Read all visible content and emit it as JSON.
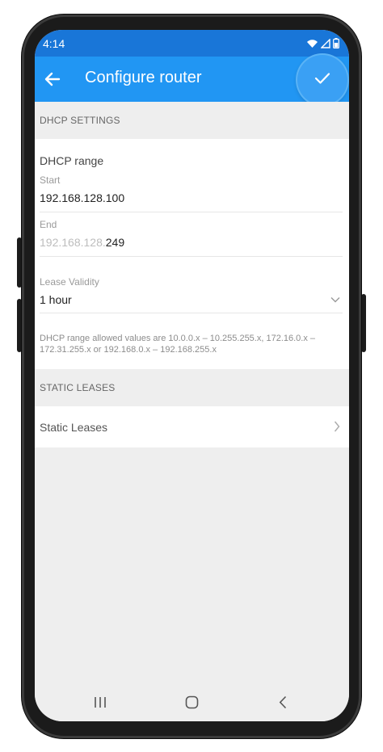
{
  "status_bar": {
    "time": "4:14",
    "icons": [
      "wifi-icon",
      "signal-icon",
      "battery-icon"
    ]
  },
  "app_bar": {
    "title": "Configure router",
    "back_icon": "arrow-left-icon",
    "confirm_icon": "check-icon"
  },
  "dhcp": {
    "section_title": "DHCP SETTINGS",
    "range_title": "DHCP range",
    "start_label": "Start",
    "start_value": "192.168.128.100",
    "end_label": "End",
    "end_prefix": "192.168.128.",
    "end_suffix": "249",
    "lease_label": "Lease Validity",
    "lease_value": "1 hour",
    "hint": "DHCP range allowed values are 10.0.0.x – 10.255.255.x, 172.16.0.x – 172.31.255.x or 192.168.0.x – 192.168.255.x"
  },
  "static": {
    "section_title": "STATIC LEASES",
    "item_label": "Static Leases"
  },
  "colors": {
    "status_bar": "#1976d8",
    "app_bar": "#2196f3",
    "background": "#eeeeee"
  },
  "nav_bar": {
    "icons": [
      "recents-icon",
      "home-icon",
      "back-nav-icon"
    ]
  }
}
